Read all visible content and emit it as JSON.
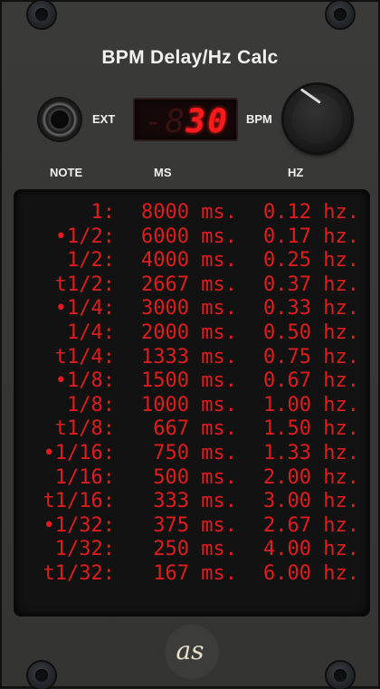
{
  "module": {
    "title": "BPM Delay/Hz Calc",
    "ext_label": "EXT",
    "bpm_label": "BPM",
    "bpm_ghost": "-8",
    "bpm_value": "30",
    "logo_text": "as"
  },
  "columns": {
    "note": "NOTE",
    "ms": "MS",
    "hz": "HZ"
  },
  "rows": [
    {
      "note": "1:",
      "ms": "8000 ms.",
      "hz": "0.12 hz."
    },
    {
      "note": "•1/2:",
      "ms": "6000 ms.",
      "hz": "0.17 hz."
    },
    {
      "note": "1/2:",
      "ms": "4000 ms.",
      "hz": "0.25 hz."
    },
    {
      "note": "t1/2:",
      "ms": "2667 ms.",
      "hz": "0.37 hz."
    },
    {
      "note": "•1/4:",
      "ms": "3000 ms.",
      "hz": "0.33 hz."
    },
    {
      "note": "1/4:",
      "ms": "2000 ms.",
      "hz": "0.50 hz."
    },
    {
      "note": "t1/4:",
      "ms": "1333 ms.",
      "hz": "0.75 hz."
    },
    {
      "note": "•1/8:",
      "ms": "1500 ms.",
      "hz": "0.67 hz."
    },
    {
      "note": "1/8:",
      "ms": "1000 ms.",
      "hz": "1.00 hz."
    },
    {
      "note": "t1/8:",
      "ms": "667 ms.",
      "hz": "1.50 hz."
    },
    {
      "note": "•1/16:",
      "ms": "750 ms.",
      "hz": "1.33 hz."
    },
    {
      "note": "1/16:",
      "ms": "500 ms.",
      "hz": "2.00 hz."
    },
    {
      "note": "t1/16:",
      "ms": "333 ms.",
      "hz": "3.00 hz."
    },
    {
      "note": "•1/32:",
      "ms": "375 ms.",
      "hz": "2.67 hz."
    },
    {
      "note": "1/32:",
      "ms": "250 ms.",
      "hz": "4.00 hz."
    },
    {
      "note": "t1/32:",
      "ms": "167 ms.",
      "hz": "6.00 hz."
    }
  ],
  "colors": {
    "led_red": "#e01c1c",
    "panel": "#373735"
  },
  "icons": {
    "screws": "screw-icon",
    "jack": "jack-icon",
    "knob": "knob-icon"
  }
}
